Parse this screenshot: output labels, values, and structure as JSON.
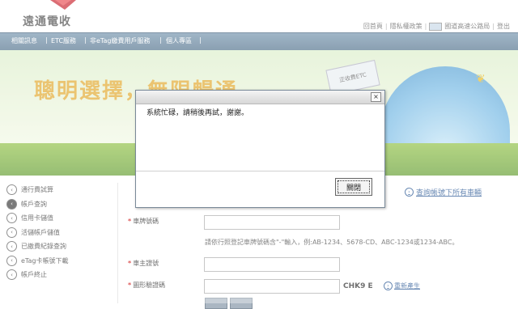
{
  "header": {
    "logo_text": "遠通電收",
    "links": [
      "回首頁",
      "隱私權政策",
      "國道高速公路局",
      "登出"
    ]
  },
  "nav": {
    "items": [
      "相關訊息",
      "ETC服務",
      "非eTag繳費用戶服務",
      "個人專區"
    ]
  },
  "banner": {
    "slogan": "聰明選擇，無限暢通",
    "sign_text": "正收費ETC"
  },
  "sidebar": {
    "items": [
      {
        "label": "通行費試算",
        "active": false
      },
      {
        "label": "帳戶查詢",
        "active": true
      },
      {
        "label": "信用卡儲值",
        "active": false
      },
      {
        "label": "活儲帳戶儲值",
        "active": false
      },
      {
        "label": "已繳費紀錄查詢",
        "active": false
      },
      {
        "label": "eTag卡帳號下載",
        "active": false
      },
      {
        "label": "帳戶終止",
        "active": false
      }
    ]
  },
  "form": {
    "query_link": "查詢帳號下所有車輛",
    "plate_label": "車牌號碼",
    "plate_hint": "請依行照登記車牌號碼含\"-\"輸入，例:AB-1234、5678-CD、ABC-1234或1234-ABC。",
    "owner_id_label": "車主證號",
    "captcha_label": "圖形驗證碼",
    "captcha_text": "CHK9 E",
    "refresh_link": "重新產生",
    "required_mark": "*"
  },
  "dialog": {
    "message": "系統忙碌，請稍後再試，謝謝。",
    "close_button": "關閉",
    "close_icon": "×"
  },
  "colors": {
    "nav_bg": "#4a6b86",
    "slogan": "#e0a525",
    "link": "#1a4b8c",
    "required": "#cc0000"
  }
}
